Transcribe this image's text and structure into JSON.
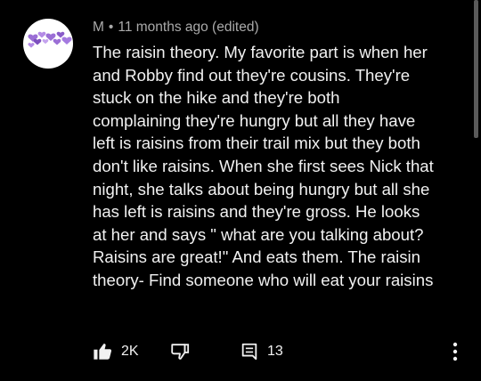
{
  "comment": {
    "author": "M",
    "separator": "•",
    "timestamp": "11 months ago (edited)",
    "text_lines": [
      "The raisin theory. My favorite part is when her",
      "and Robby find out they're cousins. They're",
      "stuck on the hike and they're both",
      "complaining they're hungry but all they have",
      "left is raisins from their trail mix but they both",
      "don't like raisins. When she first sees Nick that",
      "night, she talks about being hungry but all she",
      "has left is raisins and they're gross. He looks",
      "at her and says \" what are you talking about?",
      "Raisins are great!\" And eats them. The raisin",
      "theory- Find someone who will eat your raisins"
    ],
    "likes": "2K",
    "replies": "13"
  },
  "icons": {
    "avatar": "purple-hearts-avatar",
    "like": "thumbs-up-icon",
    "dislike": "thumbs-down-icon",
    "replies": "comment-icon",
    "more": "more-vert-icon"
  },
  "colors": {
    "background": "#000000",
    "text": "#f1f1f1",
    "meta": "#aaaaaa",
    "avatar_bg": "#ffffff",
    "hearts": "#9b6fd6"
  }
}
